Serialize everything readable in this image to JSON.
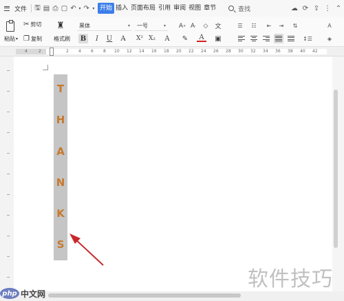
{
  "topbar": {
    "file_label": "文件",
    "tabs": [
      {
        "label": "开始",
        "active": true
      },
      {
        "label": "插入"
      },
      {
        "label": "页面布局"
      },
      {
        "label": "引用"
      },
      {
        "label": "审阅"
      },
      {
        "label": "视图"
      },
      {
        "label": "章节"
      }
    ],
    "search_label": "查找"
  },
  "ribbon": {
    "paste_label": "粘贴",
    "cut_label": "剪切",
    "copy_label": "复制",
    "format_painter_label": "格式刷",
    "font_name": "黑体",
    "font_size": "一号",
    "bold": "B",
    "italic": "I",
    "underline": "U"
  },
  "ruler": {
    "numbers": [
      "4",
      "2",
      "2",
      "4",
      "6",
      "8",
      "10",
      "12",
      "14",
      "16",
      "18",
      "20",
      "22",
      "24",
      "26",
      "28",
      "30",
      "32",
      "34",
      "36",
      "38",
      "40",
      "42"
    ]
  },
  "document": {
    "letters": [
      "T",
      "H",
      "A",
      "N",
      "K",
      "S"
    ],
    "letter_color": "#c77a2e",
    "textbox_fill": "#c5c5c5",
    "arrow_color": "#c8282d"
  },
  "watermarks": {
    "php_badge": "php",
    "php_text": "中文网",
    "site_text": "软件技巧"
  },
  "colors": {
    "active_tab": "#3d7ee8"
  }
}
